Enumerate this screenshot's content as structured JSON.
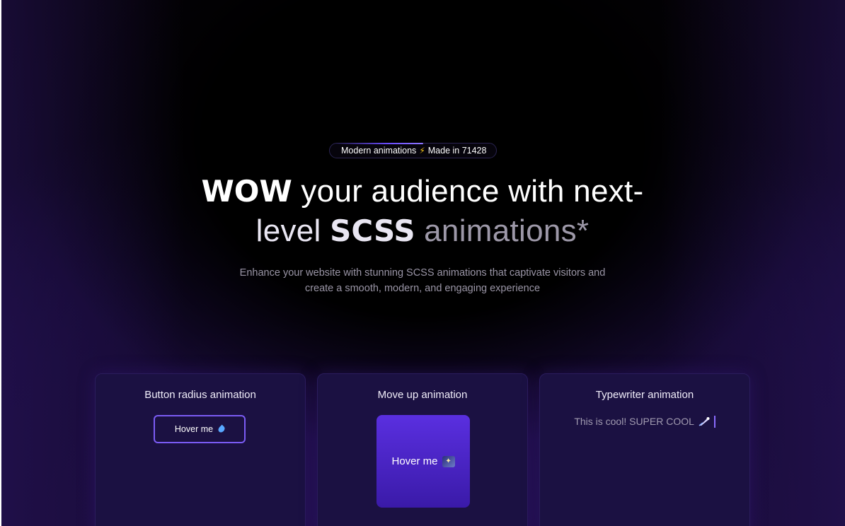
{
  "badge": {
    "text_before": "Modern animations",
    "icon": "lightning-icon",
    "text_after": "Made in 71428"
  },
  "headline": {
    "line1_strong": "WOW",
    "line1_rest": " your audience with next-",
    "line2_start": "level ",
    "line2_strong": "SCSS",
    "line2_end": " animations*"
  },
  "subtitle": {
    "line1": "Enhance your website with stunning SCSS animations that captivate visitors and",
    "line2": "create a smooth, modern, and engaging experience"
  },
  "cards": [
    {
      "title": "Button radius animation",
      "button_label": "Hover me",
      "icon": "droplet-icon"
    },
    {
      "title": "Move up animation",
      "button_label": "Hover me",
      "icon": "night-sky-icon"
    },
    {
      "title": "Typewriter animation",
      "text": "This is cool! SUPER COOL",
      "icon": "comet-icon"
    }
  ],
  "colors": {
    "accent": "#7b5cf5",
    "card_bg": "#1b1142",
    "button_fill": "#4a25c8",
    "bolt": "#f5c518"
  }
}
